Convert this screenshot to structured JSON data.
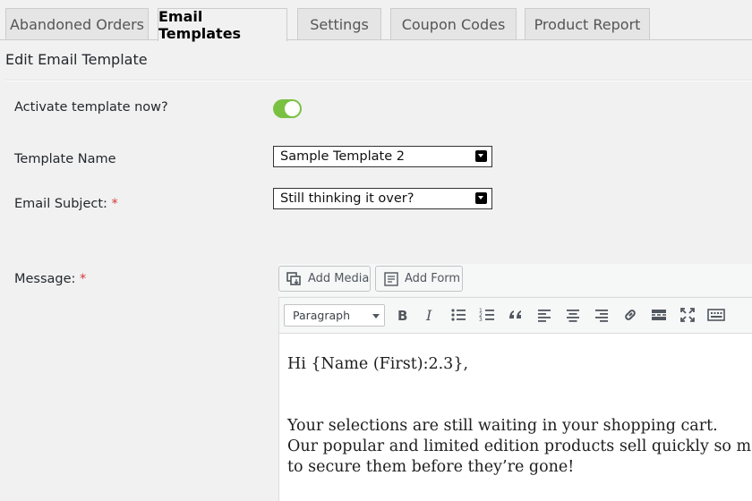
{
  "tabs": [
    {
      "label": "Abandoned Orders",
      "active": false
    },
    {
      "label": "Email Templates",
      "active": true
    },
    {
      "label": "Settings",
      "active": false
    },
    {
      "label": "Coupon Codes",
      "active": false
    },
    {
      "label": "Product Report",
      "active": false
    }
  ],
  "page_title": "Edit Email Template",
  "form": {
    "activate_label": "Activate template now?",
    "activate_on": true,
    "template_name_label": "Template Name",
    "template_name_value": "Sample Template 2",
    "subject_label": "Email Subject:",
    "subject_value": "Still thinking it over?",
    "message_label": "Message:",
    "required_mark": "*"
  },
  "editor": {
    "add_media_label": "Add Media",
    "add_form_label": "Add Form",
    "format_value": "Paragraph",
    "content": {
      "line1": "Hi {Name (First):2.3},",
      "line2": "Your selections are still waiting in your shopping cart.",
      "line3": "Our popular and limited edition products sell quickly so make",
      "line4": "to secure them before they’re gone!"
    }
  },
  "colors": {
    "toggle_on": "#7ac142",
    "required": "#d63638",
    "background": "#f1f1f1"
  }
}
